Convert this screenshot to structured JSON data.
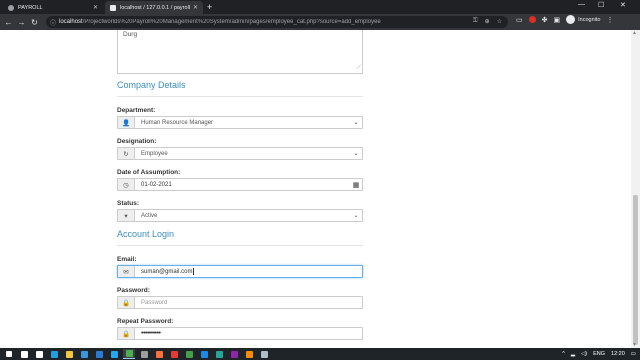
{
  "browser": {
    "tabs": [
      {
        "title": "PAYROLL"
      },
      {
        "title": "localhost / 127.0.0.1 / payroll_sy"
      }
    ],
    "new_tab": "+",
    "window_controls": {
      "minimize": "—",
      "maximize": "☐",
      "close": "✕"
    },
    "url_host": "localhost",
    "url_path": "/Projectworlds%20Payroll%20Management%20System/admin/pages/employee_cat.php?source=add_employee",
    "profile_label": "Incognito"
  },
  "form": {
    "address_value": "Durg",
    "company_section_title": "Company Details",
    "department_label": "Department:",
    "department_value": "Human Resource Manager",
    "designation_label": "Designation:",
    "designation_value": "Employee",
    "assumption_label": "Date of Assumption:",
    "assumption_value": "01-02-2021",
    "status_label": "Status:",
    "status_value": "Active",
    "account_section_title": "Account Login",
    "email_label": "Email:",
    "email_value": "suman@gmail.com",
    "password_label": "Password:",
    "password_placeholder": "Password",
    "repeat_label": "Repeat Password:",
    "repeat_value": "••••••••••"
  },
  "taskbar": {
    "apps": [
      {
        "name": "start",
        "color": "#ffffff"
      },
      {
        "name": "search",
        "color": "#ffffff"
      },
      {
        "name": "task-view",
        "color": "#ffffff"
      },
      {
        "name": "edge",
        "color": "#1fa0e0"
      },
      {
        "name": "explorer",
        "color": "#f4c542"
      },
      {
        "name": "store",
        "color": "#3a96dd"
      },
      {
        "name": "mail",
        "color": "#2a7ad5"
      },
      {
        "name": "vscode",
        "color": "#23a9f2"
      },
      {
        "name": "chrome",
        "color": "#4caf50"
      },
      {
        "name": "terminal",
        "color": "#9e9e9e"
      },
      {
        "name": "firefox",
        "color": "#ff7139"
      },
      {
        "name": "app-red",
        "color": "#e53935"
      },
      {
        "name": "app-green",
        "color": "#43a047"
      },
      {
        "name": "app-blue",
        "color": "#1e88e5"
      },
      {
        "name": "app-teal",
        "color": "#26a69a"
      },
      {
        "name": "app-purple",
        "color": "#8e24aa"
      },
      {
        "name": "app-orange",
        "color": "#fb8c00"
      },
      {
        "name": "app-gray",
        "color": "#b0bec5"
      }
    ],
    "language": "ENG",
    "time": "12:20"
  },
  "colors": {
    "accent": "#3c8dbc",
    "chrome_dark": "#202124",
    "chrome_toolbar": "#35363a"
  }
}
